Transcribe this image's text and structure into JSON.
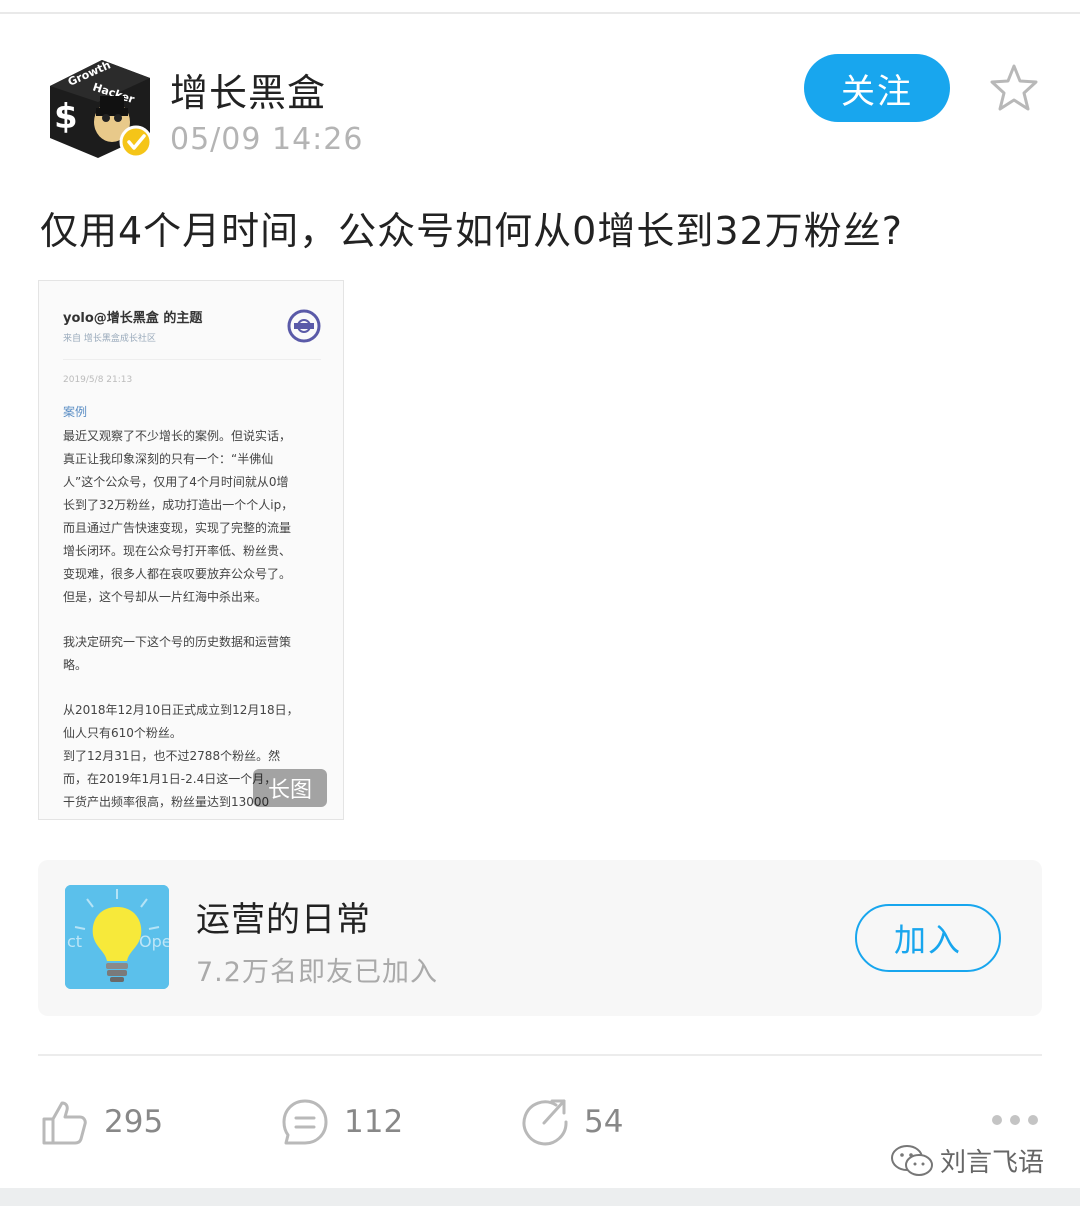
{
  "post": {
    "author": "增长黑盒",
    "timestamp": "05/09 14:26",
    "follow_label": "关注",
    "title": "仅用4个月时间，公众号如何从0增长到32万粉丝?",
    "avatar_text": [
      "Growth",
      "Hacker"
    ]
  },
  "long_image": {
    "header": "yolo@增长黑盒 的主题",
    "source": "来自 增长黑盒成长社区",
    "date": "2019/5/8 21:13",
    "tag": "案例",
    "lines": [
      "最近又观察了不少增长的案例。但说实话，",
      "真正让我印象深刻的只有一个：“半佛仙",
      "人”这个公众号，仅用了4个月时间就从0增",
      "长到了32万粉丝，成功打造出一个个人ip，",
      "而且通过广告快速变现，实现了完整的流量",
      "增长闭环。现在公众号打开率低、粉丝贵、",
      "变现难，很多人都在哀叹要放弃公众号了。",
      "但是，这个号却从一片红海中杀出来。",
      "",
      "我决定研究一下这个号的历史数据和运营策",
      "略。",
      "",
      "从2018年12月10日正式成立到12月18日，",
      "仙人只有610个粉丝。",
      "到了12月31日，也不过2788个粉丝。然",
      "而，在2019年1月1日-2.4日这一个月，",
      "干货产出频率很高，粉丝量达到13000"
    ],
    "badge": "长图"
  },
  "community": {
    "name": "运营的日常",
    "members": "7.2万名即友已加入",
    "join_label": "加入",
    "icon_text_left": "ct",
    "icon_text_right": "Ope"
  },
  "actions": {
    "likes": "295",
    "comments": "112",
    "reposts": "54"
  },
  "watermark": {
    "text": "刘言飞语"
  },
  "colors": {
    "accent": "#18a6ee",
    "verified": "#f5c518"
  }
}
